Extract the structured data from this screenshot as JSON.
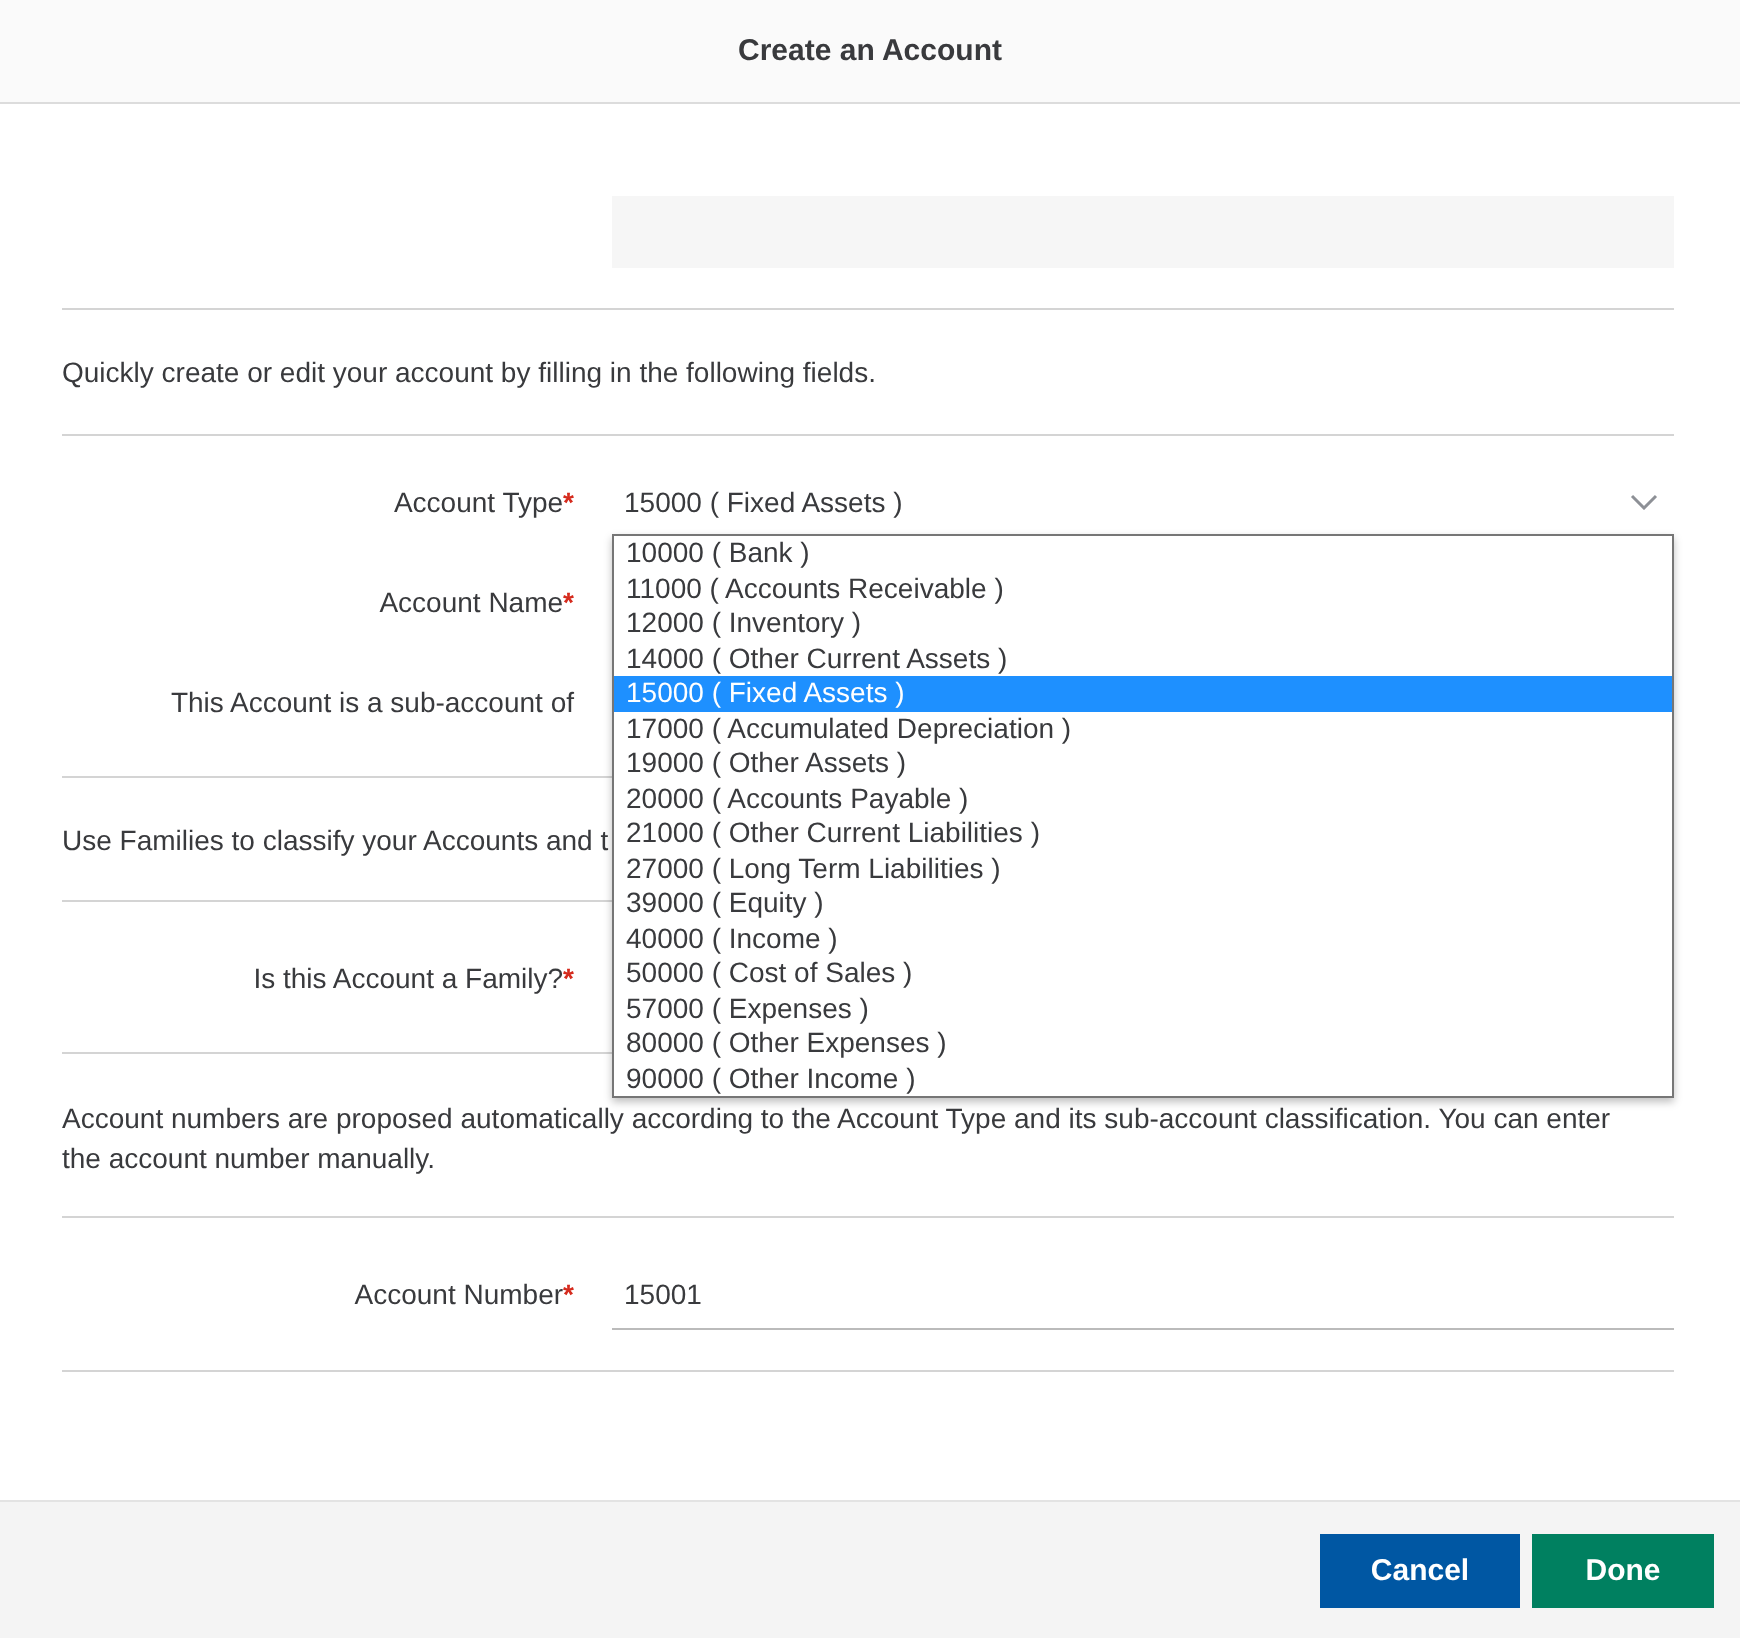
{
  "window": {
    "title": "Create an Account"
  },
  "required_mark": "*",
  "intro": "Quickly create or edit your account by filling in the following fields.",
  "fields": [
    {
      "kind": "select",
      "label": "Account Type",
      "required": true,
      "value": "15000 ( Fixed Assets )",
      "expanded": true,
      "options": [
        {
          "label": "10000 ( Bank )",
          "selected": false
        },
        {
          "label": "11000 ( Accounts Receivable )",
          "selected": false
        },
        {
          "label": "12000 ( Inventory )",
          "selected": false
        },
        {
          "label": "14000 ( Other Current Assets )",
          "selected": false
        },
        {
          "label": "15000 ( Fixed Assets )",
          "selected": true
        },
        {
          "label": "17000 ( Accumulated Depreciation )",
          "selected": false
        },
        {
          "label": "19000 ( Other Assets )",
          "selected": false
        },
        {
          "label": "20000 ( Accounts Payable )",
          "selected": false
        },
        {
          "label": "21000 ( Other Current Liabilities )",
          "selected": false
        },
        {
          "label": "27000 ( Long Term Liabilities )",
          "selected": false
        },
        {
          "label": "39000 ( Equity )",
          "selected": false
        },
        {
          "label": "40000 ( Income )",
          "selected": false
        },
        {
          "label": "50000 ( Cost of Sales )",
          "selected": false
        },
        {
          "label": "57000 ( Expenses )",
          "selected": false
        },
        {
          "label": "80000 ( Other Expenses )",
          "selected": false
        },
        {
          "label": "90000 ( Other Income )",
          "selected": false
        }
      ]
    },
    {
      "kind": "text",
      "label": "Account Name",
      "required": true
    },
    {
      "kind": "text",
      "label": "This Account is a sub-account of",
      "required": false
    }
  ],
  "families_note": "Use Families to classify your Accounts and t",
  "family_field": {
    "label": "Is this Account a Family?",
    "required": true
  },
  "number_note": "Account numbers are proposed automatically according to the Account Type and its sub-account classification. You can enter the account number manually.",
  "number_field": {
    "label": "Account Number",
    "required": true,
    "value": "15001"
  },
  "buttons": [
    {
      "label": "Cancel",
      "kind": "secondary"
    },
    {
      "label": "Done",
      "kind": "primary"
    }
  ]
}
